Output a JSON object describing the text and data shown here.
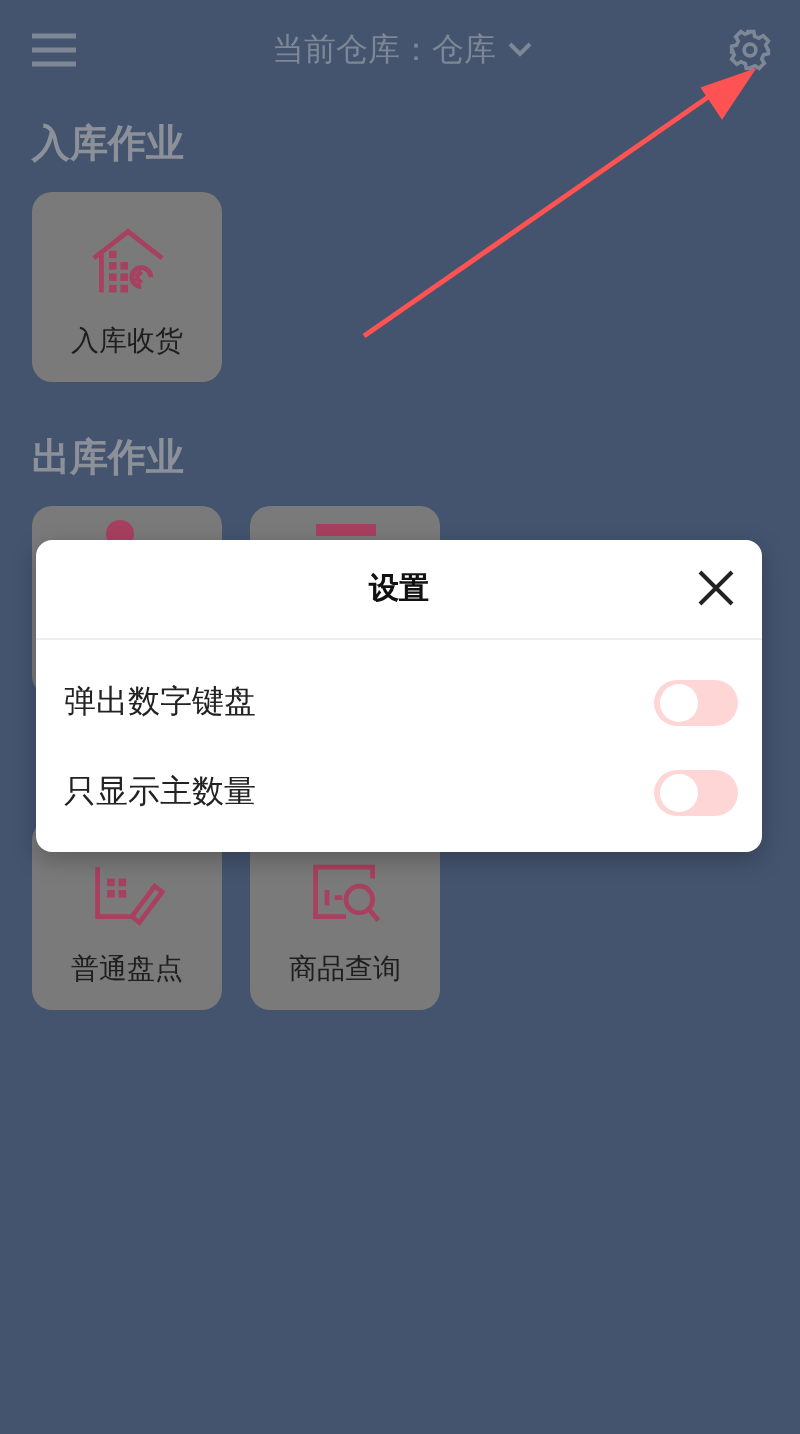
{
  "header": {
    "title": "当前仓库：仓库"
  },
  "sections": [
    {
      "title": "入库作业",
      "tiles": [
        {
          "label": "入库收货",
          "kind": "inbound"
        }
      ]
    },
    {
      "title": "出库作业",
      "tiles": [
        {
          "kind": "outbound"
        },
        {
          "kind": "picking"
        }
      ]
    },
    {
      "tiles": [
        {
          "label": "普通盘点",
          "kind": "count"
        },
        {
          "label": "商品查询",
          "kind": "query"
        }
      ]
    }
  ],
  "dialog": {
    "title": "设置",
    "settings": [
      {
        "label": "弹出数字键盘",
        "on": false
      },
      {
        "label": "只显示主数量",
        "on": false
      }
    ]
  }
}
